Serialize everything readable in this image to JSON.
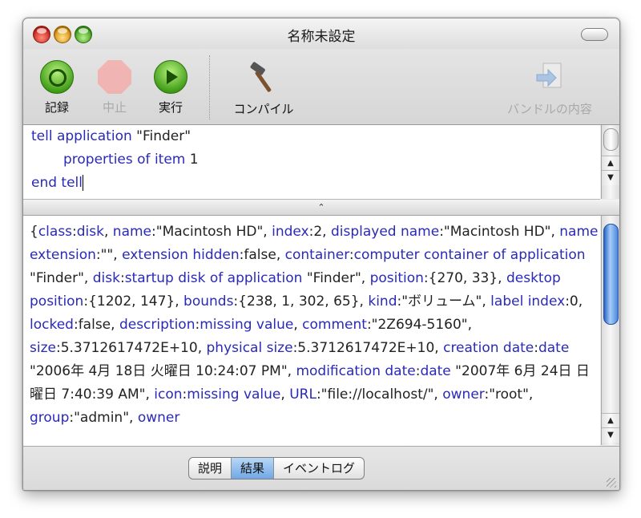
{
  "window": {
    "title": "名称未設定"
  },
  "toolbar": {
    "record_label": "記録",
    "stop_label": "中止",
    "run_label": "実行",
    "compile_label": "コンパイル",
    "bundle_label": "バンドルの内容"
  },
  "script": {
    "line1_kw1": "tell application",
    "line1_str": " \"Finder\"",
    "line2_kw": "properties of item",
    "line2_num": " 1",
    "line3_kw": "end tell"
  },
  "result": {
    "segments": [
      {
        "t": "{",
        "b": false
      },
      {
        "t": "class",
        "b": true
      },
      {
        "t": ":",
        "b": false
      },
      {
        "t": "disk",
        "b": true
      },
      {
        "t": ", ",
        "b": false
      },
      {
        "t": "name",
        "b": true
      },
      {
        "t": ":\"Macintosh HD\", ",
        "b": false
      },
      {
        "t": "index",
        "b": true
      },
      {
        "t": ":2, ",
        "b": false
      },
      {
        "t": "displayed name",
        "b": true
      },
      {
        "t": ":\"Macintosh HD\", ",
        "b": false
      },
      {
        "t": "name extension",
        "b": true
      },
      {
        "t": ":\"\", ",
        "b": false
      },
      {
        "t": "extension hidden",
        "b": true
      },
      {
        "t": ":false, ",
        "b": false
      },
      {
        "t": "container",
        "b": true
      },
      {
        "t": ":",
        "b": false
      },
      {
        "t": "computer container of application",
        "b": true
      },
      {
        "t": " \"Finder\", ",
        "b": false
      },
      {
        "t": "disk",
        "b": true
      },
      {
        "t": ":",
        "b": false
      },
      {
        "t": "startup disk of application",
        "b": true
      },
      {
        "t": " \"Finder\", ",
        "b": false
      },
      {
        "t": "position",
        "b": true
      },
      {
        "t": ":{270, 33}, ",
        "b": false
      },
      {
        "t": "desktop position",
        "b": true
      },
      {
        "t": ":{1202, 147}, ",
        "b": false
      },
      {
        "t": "bounds",
        "b": true
      },
      {
        "t": ":{238, 1, 302, 65}, ",
        "b": false
      },
      {
        "t": "kind",
        "b": true
      },
      {
        "t": ":\"ボリューム\", ",
        "b": false
      },
      {
        "t": "label index",
        "b": true
      },
      {
        "t": ":0, ",
        "b": false
      },
      {
        "t": "locked",
        "b": true
      },
      {
        "t": ":false, ",
        "b": false
      },
      {
        "t": "description",
        "b": true
      },
      {
        "t": ":",
        "b": false
      },
      {
        "t": "missing value",
        "b": true
      },
      {
        "t": ", ",
        "b": false
      },
      {
        "t": "comment",
        "b": true
      },
      {
        "t": ":\"2Z694-5160\", ",
        "b": false
      },
      {
        "t": "size",
        "b": true
      },
      {
        "t": ":5.3712617472E+10, ",
        "b": false
      },
      {
        "t": "physical size",
        "b": true
      },
      {
        "t": ":5.3712617472E+10, ",
        "b": false
      },
      {
        "t": "creation date",
        "b": true
      },
      {
        "t": ":",
        "b": false
      },
      {
        "t": "date",
        "b": true
      },
      {
        "t": " \"2006年 4月 18日 火曜日 10:24:07 PM\", ",
        "b": false
      },
      {
        "t": "modification date",
        "b": true
      },
      {
        "t": ":",
        "b": false
      },
      {
        "t": "date",
        "b": true
      },
      {
        "t": " \"2007年 6月 24日 日曜日 7:40:39 AM\", ",
        "b": false
      },
      {
        "t": "icon",
        "b": true
      },
      {
        "t": ":",
        "b": false
      },
      {
        "t": "missing value",
        "b": true
      },
      {
        "t": ", ",
        "b": false
      },
      {
        "t": "URL",
        "b": true
      },
      {
        "t": ":\"file://localhost/\", ",
        "b": false
      },
      {
        "t": "owner",
        "b": true
      },
      {
        "t": ":\"root\", ",
        "b": false
      },
      {
        "t": "group",
        "b": true
      },
      {
        "t": ":\"admin\", ",
        "b": false
      },
      {
        "t": "owner",
        "b": true
      }
    ]
  },
  "tabs": [
    {
      "label": "説明",
      "selected": false
    },
    {
      "label": "結果",
      "selected": true
    },
    {
      "label": "イベントログ",
      "selected": false
    }
  ],
  "colors": {
    "keyword": "#2a2ab8",
    "selected_tab": "#6fa7e6",
    "scroll_thumb": "#4a86de"
  }
}
